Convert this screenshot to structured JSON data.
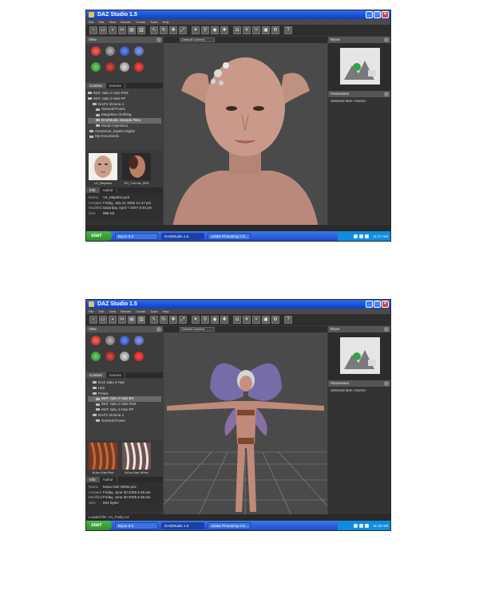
{
  "window_title": "DAZ Studio 1.5",
  "menus": [
    "File",
    "Edit",
    "View",
    "Render",
    "Create",
    "Tools",
    "Help"
  ],
  "panels": {
    "view_title": "View",
    "content_tab": "Content",
    "scenes_tab": "Scenes",
    "info_tab": "Info",
    "author_tab": "Author",
    "bryce_title": "Bryce",
    "parameters_title": "Parameters",
    "selected_item_label": "Selected Item",
    "selected_item_value": "<None>",
    "camera": "Default Camera"
  },
  "top": {
    "tree": [
      "MAT Juku 3 Hair-PSS",
      "MAT Juku 3 Hair-PF",
      "DAZ's Victoria 4",
      "General Poses",
      "MagicBox Clothing",
      "DAZStudio Sample Files",
      "Morph Injections",
      "OneDome_Mystic-Nights",
      "My Documents"
    ],
    "selected_row": 5,
    "thumbs": [
      "V4_Mapless",
      "SO_Full-res_5HS"
    ],
    "info": {
      "name_label": "Name",
      "name": "V4_Mapless.pz2",
      "created_label": "Created",
      "created": "Friday, July 21 2006 12:47 pm",
      "modified_label": "Modified",
      "modified": "Saturday, April 7 2007 9:40 pm",
      "size_label": "Size",
      "size": "995 Kb"
    },
    "status": "",
    "tasks": [
      "Bryce 5.5",
      "DAZ|Studio 1.5",
      "Adobe Photoshop CS..."
    ],
    "clock": "11:17 AM"
  },
  "bottom": {
    "tree": [
      "DAZ Juku 3 Hair",
      "Hair",
      "Poses",
      "MAT Juku 3 Hair-B4",
      "MAT Juku 3 Hair-PSS",
      "MAT Juku 3 Hair-PF",
      "DAZ's Victoria 4",
      "General Poses"
    ],
    "selected_row": 3,
    "thumbs": [
      "MJuu Hair Red",
      "MJuu Hair White"
    ],
    "info": {
      "name_label": "Name",
      "name": "MJuu Hair White.pz2",
      "created_label": "Created",
      "created": "Friday, June 30 2006 6:48 am",
      "modified_label": "Modified",
      "modified": "Friday, June 30 2006 6:48 am",
      "size_label": "Size",
      "size": "502 bytes"
    },
    "status": "Loaded file: V4_Fairly.cr2",
    "tasks": [
      "Bryce 5.5",
      "DAZ|Studio 1.5",
      "Adobe Photoshop CS..."
    ],
    "clock": "11:25 AM"
  },
  "start_label": "start",
  "colors": {
    "xp_blue": "#1f4ccc",
    "start_green": "#3aa03a",
    "skin": "#c99080",
    "dark_ui": "#3a3a3a"
  }
}
